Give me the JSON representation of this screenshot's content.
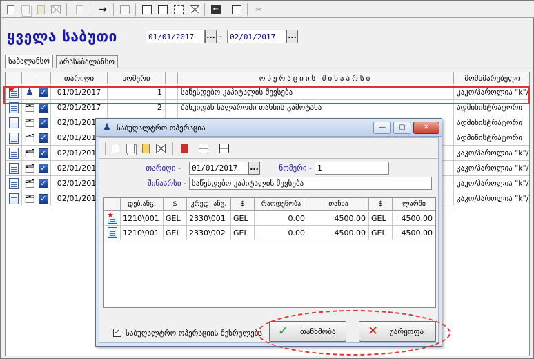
{
  "colors": {
    "title": "#1a1aa8",
    "highlight": "#e0342f",
    "dialog_frame": "#dbe4f1"
  },
  "toolbar_icons": [
    "new-doc-icon",
    "copy-doc-icon",
    "open-folder-icon",
    "delete-icon",
    "paste-icon",
    "arrow-right-icon",
    "save-icon",
    "frame-icon",
    "split-icon",
    "resize-icon",
    "close-box-icon",
    "back-arrow-icon",
    "export-icon",
    "tools-icon"
  ],
  "title": "ყველა საბუთი",
  "date_from": "01/01/2017",
  "date_to": "02/01/2017",
  "dots": "...",
  "dash": "-",
  "tabs": [
    "საბალანსო",
    "არასაბალანსო"
  ],
  "grid": {
    "headers": {
      "date": "თარიღი",
      "number": "ნომერი",
      "content": "ოპერაციის შინაარსი",
      "user": "მომხმარებელი"
    },
    "rows": [
      {
        "date": "01/01/2017",
        "number": "1",
        "content": "საწესდებო კაპიტალის შევსება",
        "user": "კაკო/პაროლია \"k\"/"
      },
      {
        "date": "02/01/2017",
        "number": "2",
        "content": "ბანკიდან სალაროში თანხის გამოტანა",
        "user": "ადმინისტრატორი"
      },
      {
        "date": "02/01/2017",
        "number": "",
        "content": "",
        "user": "ადმინისტრატორი"
      },
      {
        "date": "02/01/2017",
        "number": "",
        "content": "",
        "user": "ადმინისტრატორი"
      },
      {
        "date": "02/01/2017",
        "number": "",
        "content": "",
        "user": "კაკო/პაროლია \"k\"/"
      },
      {
        "date": "02/01/2017",
        "number": "",
        "content": "",
        "user": "კაკო/პაროლია \"k\"/"
      },
      {
        "date": "02/01/2017",
        "number": "",
        "content": "",
        "user": "კაკო/პაროლია \"k\"/"
      },
      {
        "date": "02/01/2017",
        "number": "",
        "content": "",
        "user": "კაკო/პაროლია \"k\"/"
      }
    ]
  },
  "dialog": {
    "title": "საბუღალტრო ოპერაცია",
    "win_buttons": {
      "minimize": "—",
      "maximize": "▢",
      "close": "✕"
    },
    "date_label": "თარიღი -",
    "date_value": "01/01/2017",
    "number_label": "ნომერი -",
    "number_value": "1",
    "content_label": "შინაარსი -",
    "content_value": "საწესდებო კაპიტალის შევსება",
    "grid_headers": {
      "debit": "დებ.ანგ.",
      "cur1": "$",
      "credit": "კრედ. ანგ.",
      "cur2": "$",
      "qty": "რაოდენობა",
      "amount": "თანხა",
      "cur3": "$",
      "lari": "ლარში"
    },
    "rows": [
      {
        "debit": "1210\\001",
        "cur1": "GEL",
        "credit": "2330\\001",
        "cur2": "GEL",
        "qty": "0.00",
        "amount": "4500.00",
        "cur3": "GEL",
        "lari": "4500.00"
      },
      {
        "debit": "1210\\001",
        "cur1": "GEL",
        "credit": "2330\\002",
        "cur2": "GEL",
        "qty": "0.00",
        "amount": "4500.00",
        "cur3": "GEL",
        "lari": "4500.00"
      }
    ],
    "checkbox_label": "საბუღალტრო ოპერაციის შესრულება",
    "checkbox_mark": "✓",
    "ok_label": "თანხმობა",
    "ok_icon": "✓",
    "cancel_label": "უარყოფა",
    "cancel_icon": "✕"
  }
}
